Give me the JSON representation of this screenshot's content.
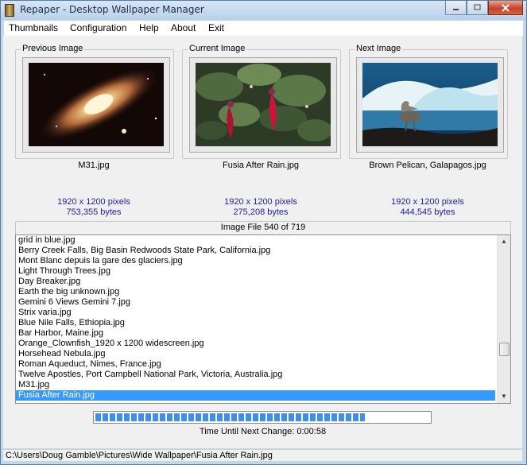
{
  "window": {
    "title": "Repaper - Desktop Wallpaper Manager",
    "controls": [
      "minimize",
      "maximize",
      "close"
    ]
  },
  "menu": [
    "Thumbnails",
    "Configuration",
    "Help",
    "About",
    "Exit"
  ],
  "previews": {
    "previous": {
      "label": "Previous Image",
      "name": "M31.jpg",
      "resolution": "1920 x 1200 pixels",
      "size": "753,355 bytes"
    },
    "current": {
      "label": "Current Image",
      "name": "Fusia After Rain.jpg",
      "resolution": "1920 x 1200 pixels",
      "size": "275,208 bytes"
    },
    "next": {
      "label": "Next Image",
      "name": "Brown Pelican, Galapagos.jpg",
      "resolution": "1920 x 1200 pixels",
      "size": "444,545 bytes"
    }
  },
  "counter": "Image File 540 of 719",
  "files": [
    "grid in blue.jpg",
    "Berry Creek Falls, Big Basin Redwoods State Park, California.jpg",
    "Mont Blanc depuis la gare des glaciers.jpg",
    "Light Through Trees.jpg",
    "Day Breaker.jpg",
    "Earth the big unknown.jpg",
    "Gemini 6 Views Gemini 7.jpg",
    "Strix varia.jpg",
    "Blue Nile Falls, Ethiopia.jpg",
    "Bar Harbor, Maine.jpg",
    "Orange_Clownfish_1920 x 1200 widescreen.jpg",
    "Horsehead Nebula.jpg",
    "Roman Aqueduct, Nimes, France.jpg",
    "Twelve Apostles, Port Campbell National Park, Victoria, Australia.jpg",
    "M31.jpg",
    "Fusia After Rain.jpg"
  ],
  "selected_file": "Fusia After Rain.jpg",
  "progress": {
    "fraction": 0.81
  },
  "timer": "Time Until Next Change: 0:00:58",
  "status_path": "C:\\Users\\Doug Gamble\\Pictures\\Wide Wallpaper\\Fusia After Rain.jpg"
}
